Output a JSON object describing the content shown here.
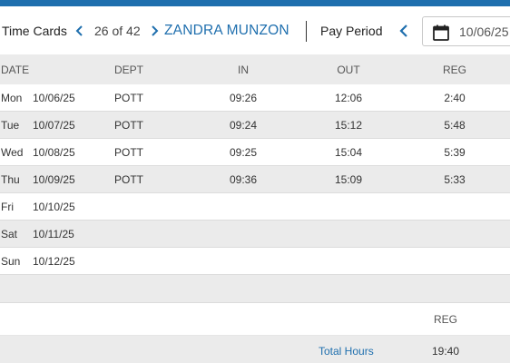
{
  "header": {
    "title": "Time Cards",
    "record_counter": "26 of 42",
    "employee_name": "ZANDRA MUNZON",
    "pay_period_label": "Pay Period",
    "date_value": "10/06/25",
    "accent_color": "#1f6fae"
  },
  "table": {
    "columns": {
      "date": "DATE",
      "dept": "DEPT",
      "in": "IN",
      "out": "OUT",
      "reg": "REG"
    },
    "rows": [
      {
        "day": "Mon",
        "date": "10/06/25",
        "dept": "POTT",
        "in": "09:26",
        "out": "12:06",
        "reg": "2:40"
      },
      {
        "day": "Tue",
        "date": "10/07/25",
        "dept": "POTT",
        "in": "09:24",
        "out": "15:12",
        "reg": "5:48"
      },
      {
        "day": "Wed",
        "date": "10/08/25",
        "dept": "POTT",
        "in": "09:25",
        "out": "15:04",
        "reg": "5:39"
      },
      {
        "day": "Thu",
        "date": "10/09/25",
        "dept": "POTT",
        "in": "09:36",
        "out": "15:09",
        "reg": "5:33"
      },
      {
        "day": "Fri",
        "date": "10/10/25",
        "dept": "",
        "in": "",
        "out": "",
        "reg": ""
      },
      {
        "day": "Sat",
        "date": "10/11/25",
        "dept": "",
        "in": "",
        "out": "",
        "reg": ""
      },
      {
        "day": "Sun",
        "date": "10/12/25",
        "dept": "",
        "in": "",
        "out": "",
        "reg": ""
      }
    ]
  },
  "summary": {
    "column_label": "REG",
    "total_label": "Total Hours",
    "total_value": "19:40"
  }
}
